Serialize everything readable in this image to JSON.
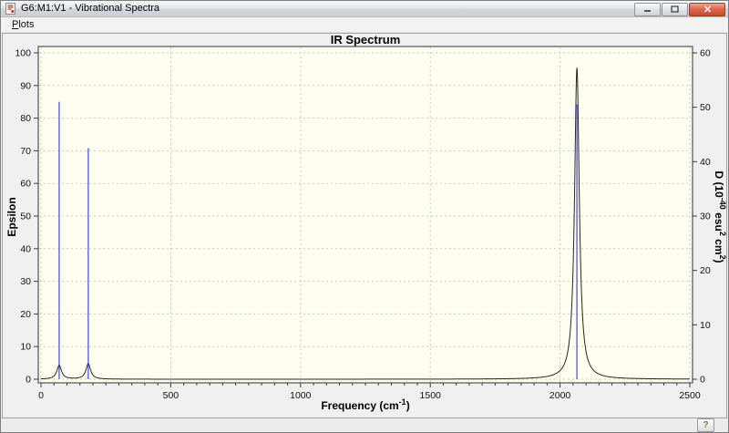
{
  "window": {
    "title": "G6:M1:V1 - Vibrational Spectra"
  },
  "menu": {
    "plots": {
      "label": "Plots",
      "accelerator": "P",
      "rest": "lots"
    }
  },
  "status": {
    "help_label": "?"
  },
  "icons": {
    "app": "app-icon",
    "minimize": "minimize-icon",
    "maximize": "maximize-icon",
    "close": "close-icon",
    "help": "help-question-icon"
  },
  "chart_data": {
    "type": "line",
    "title": "IR Spectrum",
    "xlabel": "Frequency (cm⁻¹)",
    "xlabel_parts": [
      {
        "t": "Frequency (cm"
      },
      {
        "t": "-1",
        "sup": true
      },
      {
        "t": ")"
      }
    ],
    "ylabel_left": "Epsilon",
    "ylabel_right": "D (10⁻⁴⁰ esu² cm²)",
    "ylabel_right_parts": [
      {
        "t": "D (10"
      },
      {
        "t": "-40",
        "sup": true
      },
      {
        "t": " esu"
      },
      {
        "t": "2",
        "sup": true
      },
      {
        "t": " cm"
      },
      {
        "t": "2",
        "sup": true
      },
      {
        "t": ")"
      }
    ],
    "xlim": [
      0,
      2500
    ],
    "ylim_left": [
      0,
      100
    ],
    "ylim_right": [
      0,
      60
    ],
    "x_major_ticks": [
      0,
      500,
      1000,
      1500,
      2000,
      2500
    ],
    "x_minor_tick_step": 50,
    "y_left_ticks": [
      0,
      10,
      20,
      30,
      40,
      50,
      60,
      70,
      80,
      90,
      100
    ],
    "y_right_ticks": [
      0,
      10,
      20,
      30,
      40,
      50,
      60
    ],
    "grid": {
      "style": "dashed",
      "color": "#c9c9c9"
    },
    "plot_background": "#fffef0",
    "series": [
      {
        "name": "dipole-strength-sticks",
        "type": "stick",
        "axis": "right",
        "color": "#6b6be0",
        "points": [
          {
            "x": 70,
            "y": 51
          },
          {
            "x": 182,
            "y": 42.5
          },
          {
            "x": 2065,
            "y": 50.5
          }
        ]
      },
      {
        "name": "epsilon-lorentzian-curve",
        "type": "lorentzian",
        "axis": "left",
        "color": "#26262a",
        "hwhm": 11,
        "peaks": [
          {
            "x": 70,
            "height": 4.2
          },
          {
            "x": 182,
            "height": 4.7
          },
          {
            "x": 2065,
            "height": 95.5
          }
        ]
      }
    ]
  }
}
